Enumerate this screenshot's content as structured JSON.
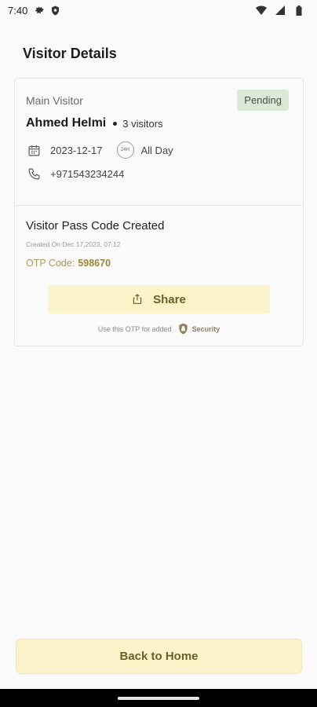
{
  "status_bar": {
    "time": "7:40"
  },
  "page": {
    "title": "Visitor Details"
  },
  "visitor": {
    "label": "Main Visitor",
    "status": "Pending",
    "name": "Ahmed Helmi",
    "count_text": "3 visitors",
    "date": "2023-12-17",
    "time_badge": "24H",
    "duration": "All Day",
    "phone": "+971543234244"
  },
  "pass": {
    "title": "Visitor Pass Code Created",
    "created": "Created On Dec 17,2023, 07:12",
    "otp_label": "OTP Code:",
    "otp_value": "598670",
    "share_label": "Share",
    "note": "Use this OTP for added",
    "security_label": "Security"
  },
  "footer": {
    "home_label": "Back to Home"
  },
  "colors": {
    "accent_bg": "#fbf4ca",
    "badge_bg": "#d9e9d6",
    "otp_gold": "#998736"
  }
}
